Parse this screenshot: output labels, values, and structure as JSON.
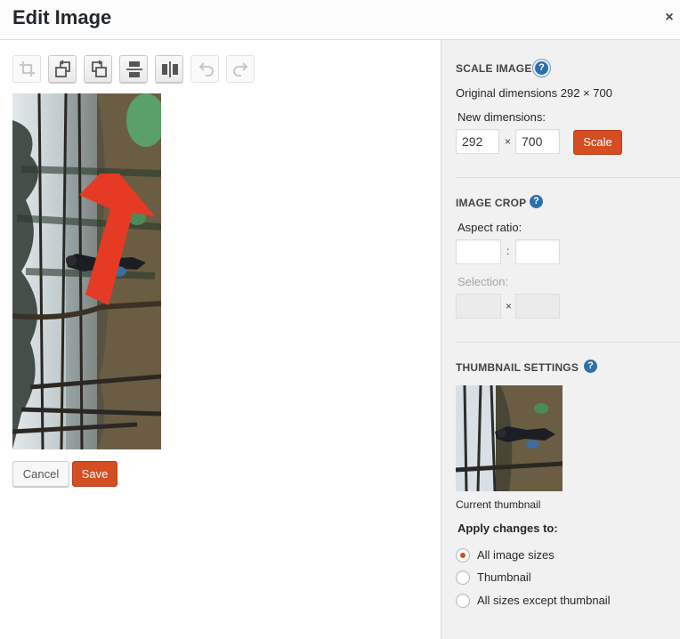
{
  "dialog": {
    "title": "Edit Image",
    "close_glyph": "×"
  },
  "toolbar": {
    "tools": [
      {
        "name": "crop",
        "icon": "crop-icon",
        "enabled": false
      },
      {
        "name": "rotate-left",
        "icon": "rotate-left-icon",
        "enabled": true
      },
      {
        "name": "rotate-right",
        "icon": "rotate-right-icon",
        "enabled": true
      },
      {
        "name": "flip-vertical",
        "icon": "flip-vertical-icon",
        "enabled": true
      },
      {
        "name": "flip-horizontal",
        "icon": "flip-horizontal-icon",
        "enabled": true
      },
      {
        "name": "undo",
        "icon": "undo-icon",
        "enabled": false
      },
      {
        "name": "redo",
        "icon": "redo-icon",
        "enabled": false
      }
    ]
  },
  "annotation": {
    "icon": "red-arrow-pointing-up",
    "color": "#e53a24"
  },
  "actions": {
    "cancel_label": "Cancel",
    "save_label": "Save"
  },
  "scale": {
    "heading": "SCALE IMAGE",
    "help_glyph": "?",
    "original_dimensions": "Original dimensions 292 × 700",
    "new_dimensions_label": "New dimensions:",
    "width_value": "292",
    "separator": "×",
    "height_value": "700",
    "button_label": "Scale"
  },
  "crop": {
    "heading": "IMAGE CROP",
    "help_glyph": "?",
    "aspect_ratio_label": "Aspect ratio:",
    "aspect_w": "",
    "aspect_separator": ":",
    "aspect_h": "",
    "selection_label": "Selection:",
    "selection_separator": "×",
    "selection_w": "",
    "selection_h": ""
  },
  "thumbnail": {
    "heading": "THUMBNAIL SETTINGS",
    "help_glyph": "?",
    "caption": "Current thumbnail",
    "apply_label": "Apply changes to:",
    "options": [
      {
        "label": "All image sizes",
        "checked": true
      },
      {
        "label": "Thumbnail",
        "checked": false
      },
      {
        "label": "All sizes except thumbnail",
        "checked": false
      }
    ]
  },
  "colors": {
    "primary_button": "#d54e21",
    "help_icon": "#2e70a8",
    "sidebar_bg": "#f1f1f1"
  }
}
